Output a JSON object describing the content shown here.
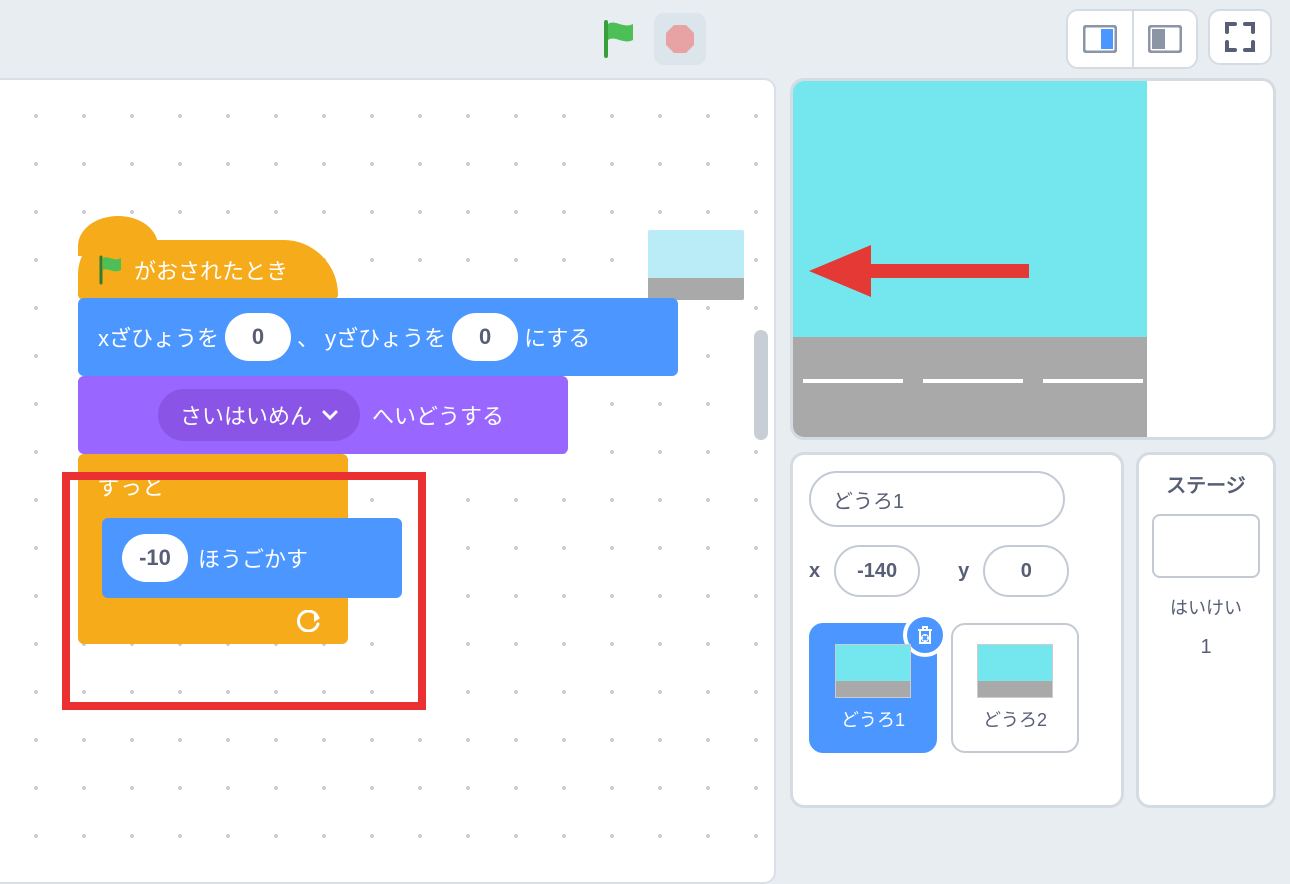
{
  "toolbar": {
    "go": "green-flag",
    "stop": "stop-sign"
  },
  "script": {
    "hat_label": "がおされたとき",
    "gotoxy": {
      "prefix1": "xざひょうを",
      "x": "0",
      "middle": "、 yざひょうを",
      "y": "0",
      "suffix": "にする"
    },
    "layer": {
      "dropdown": "さいはいめん",
      "suffix": "へいどうする"
    },
    "forever": "ずっと",
    "move": {
      "value": "-10",
      "suffix": "ほうごかす"
    }
  },
  "spritePanel": {
    "name": "どうろ1",
    "xLabel": "x",
    "xVal": "-140",
    "yLabel": "y",
    "yVal": "0",
    "sprites": [
      {
        "label": "どうろ1"
      },
      {
        "label": "どうろ2"
      }
    ]
  },
  "stagePanel": {
    "title": "ステージ",
    "backdropLabel": "はいけい",
    "backdropCount": "1"
  }
}
